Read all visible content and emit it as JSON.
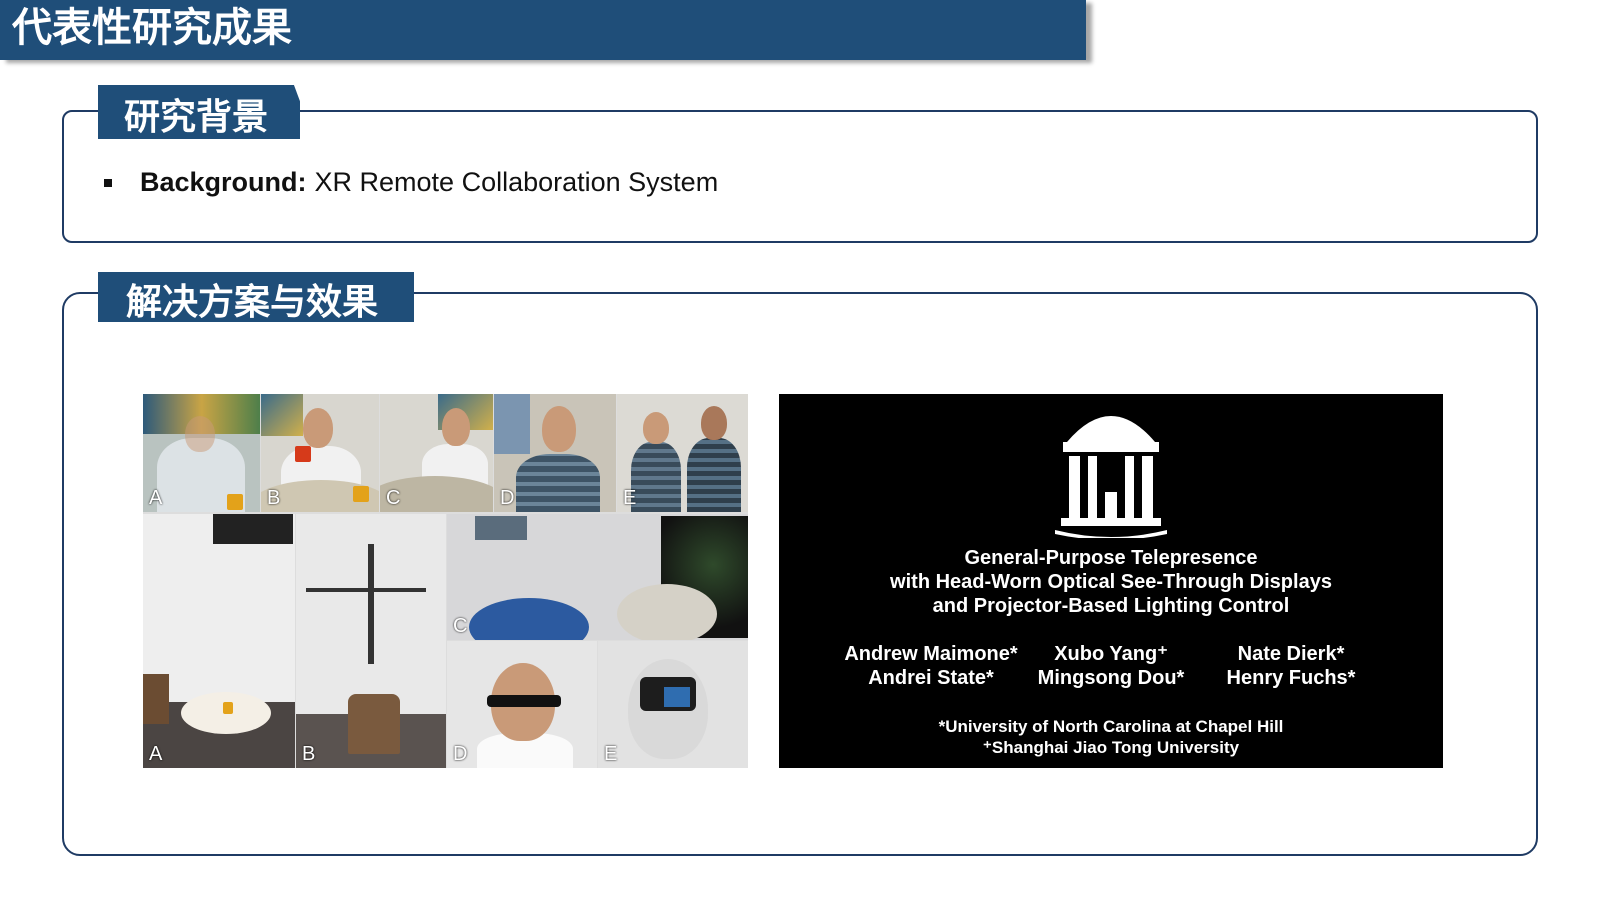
{
  "page_title": "代表性研究成果",
  "section1": {
    "title": "研究背景",
    "bullet_label": "Background:",
    "bullet_text": "XR Remote Collaboration System"
  },
  "section2": {
    "title": "解决方案与效果"
  },
  "collage": {
    "top_labels": [
      "A",
      "B",
      "C",
      "D",
      "E"
    ],
    "bottom_labels": [
      "A",
      "B",
      "C",
      "D",
      "E"
    ]
  },
  "credits": {
    "title_lines": [
      "General-Purpose Telepresence",
      "with Head-Worn Optical See-Through Displays",
      "and Projector-Based Lighting Control"
    ],
    "authors": [
      "Andrew Maimone*",
      "Xubo Yang⁺",
      "Nate Dierk*",
      "Andrei State*",
      "Mingsong Dou*",
      "Henry Fuchs*"
    ],
    "affiliations": [
      "*University of North Carolina at Chapel Hill",
      "⁺Shanghai Jiao Tong University"
    ]
  },
  "colors": {
    "header_blue": "#1f4e79",
    "panel_border": "#1f3b64",
    "mug_yellow": "#e3a21a"
  }
}
